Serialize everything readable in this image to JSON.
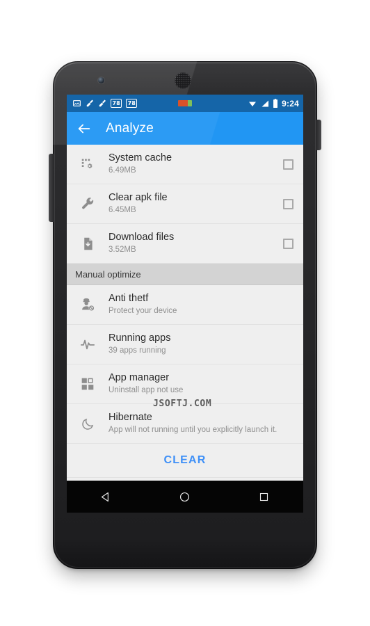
{
  "app": {
    "toolbar_title": "Analyze",
    "back_icon": "back-arrow-icon",
    "accent_color": "#2196f3",
    "clear_accent_color": "#3f90f7",
    "screen_bg": "#efefef"
  },
  "status_bar": {
    "clock": "9:24",
    "left_icons": [
      {
        "name": "image-icon",
        "label": ""
      },
      {
        "name": "broom-icon-1",
        "label": ""
      },
      {
        "name": "broom-icon-2",
        "label": ""
      }
    ],
    "badges": [
      "78",
      "78"
    ],
    "usb_indicator": "usb-charge-icon",
    "right_icons": [
      {
        "name": "wifi-icon"
      },
      {
        "name": "signal-icon"
      },
      {
        "name": "battery-icon"
      }
    ]
  },
  "list": {
    "scan_items": [
      {
        "icon": "system-cache-icon",
        "title": "System cache",
        "subtitle": "6.49MB",
        "checked": false
      },
      {
        "icon": "wrench-icon",
        "title": "Clear apk file",
        "subtitle": "6.45MB",
        "checked": false
      },
      {
        "icon": "download-file-icon",
        "title": "Download files",
        "subtitle": "3.52MB",
        "checked": false
      }
    ],
    "section_header": "Manual optimize",
    "manual_items": [
      {
        "icon": "anti-theft-icon",
        "title": "Anti thetf",
        "subtitle": "Protect your device"
      },
      {
        "icon": "pulse-icon",
        "title": "Running apps",
        "subtitle": "39 apps running"
      },
      {
        "icon": "app-manager-icon",
        "title": "App manager",
        "subtitle": "Uninstall app not use"
      },
      {
        "icon": "moon-icon",
        "title": "Hibernate",
        "subtitle": "App will not running until you explicitly launch it."
      }
    ],
    "clear_button": "CLEAR"
  },
  "watermark": {
    "text": "JSOFTJ.COM"
  },
  "navbar": {
    "back": "nav-back-icon",
    "home": "nav-home-icon",
    "recents": "nav-recents-icon"
  }
}
